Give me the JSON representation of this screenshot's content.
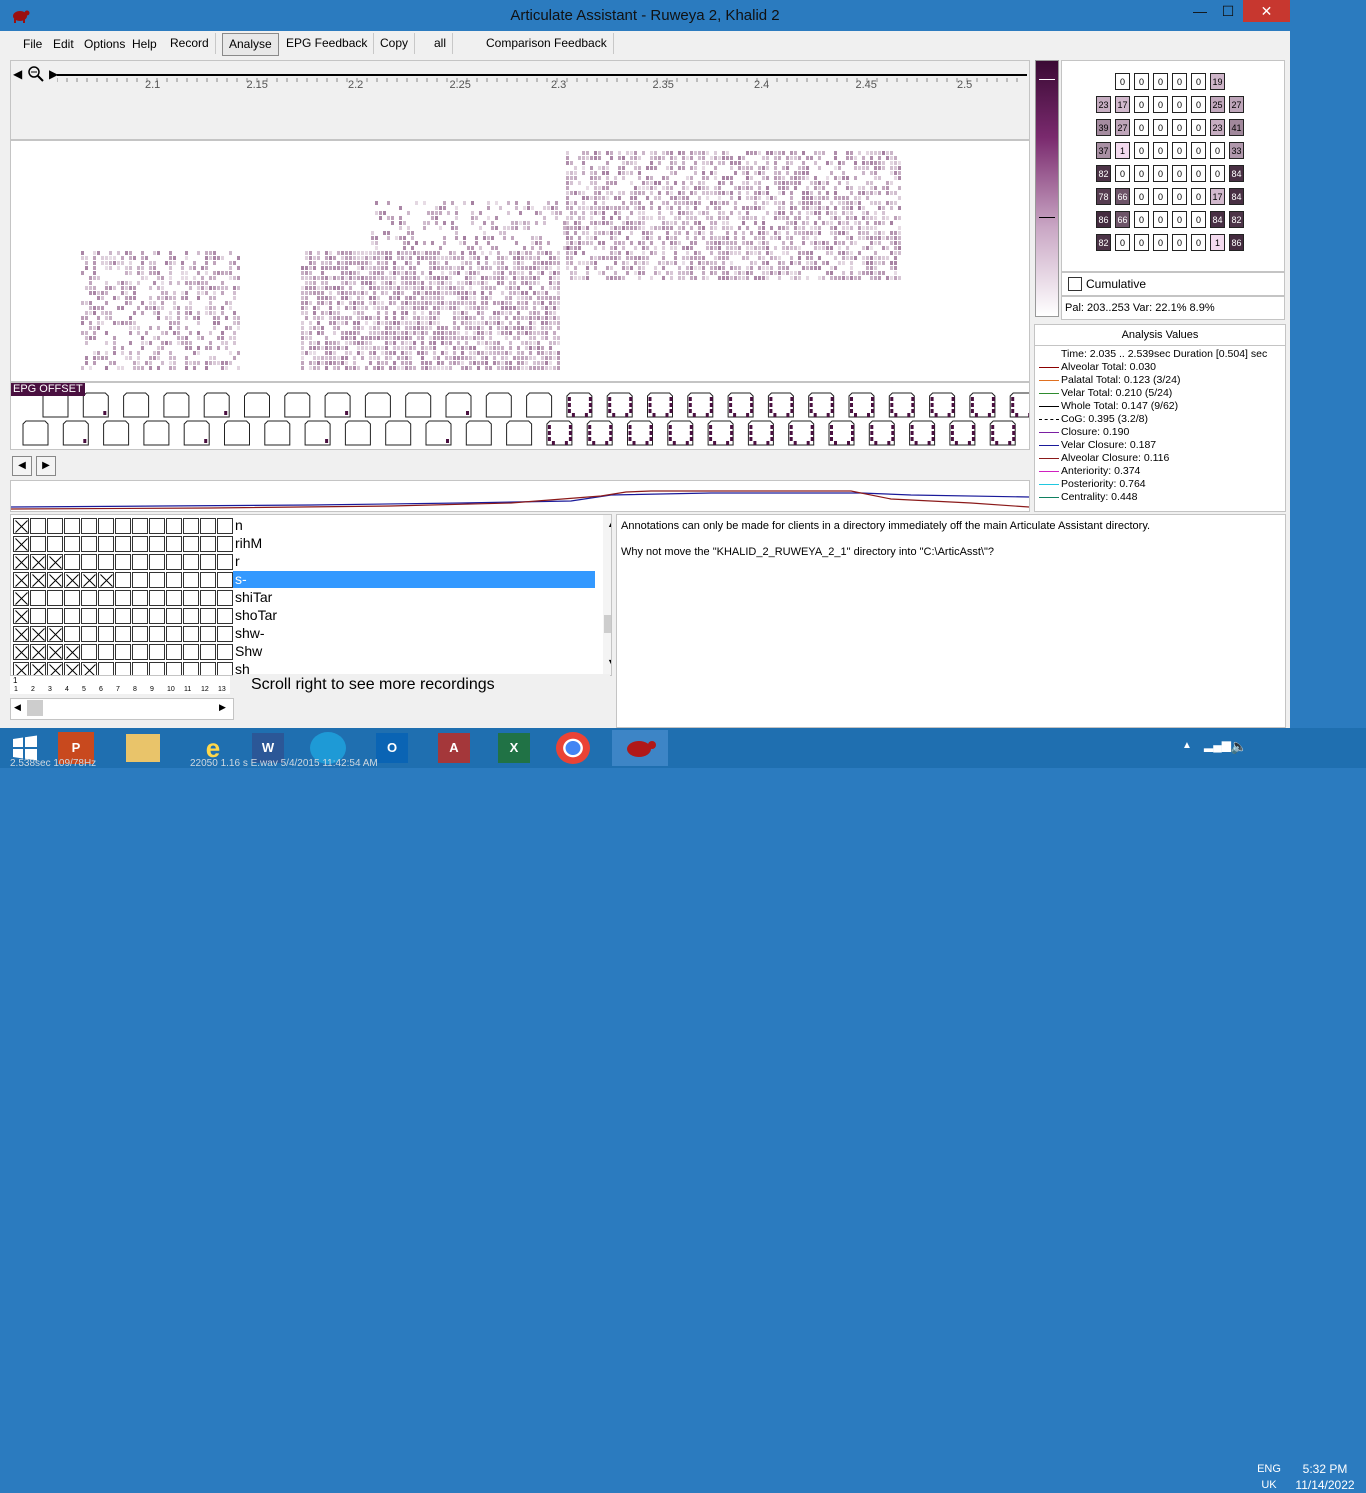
{
  "window": {
    "title": "Articulate Assistant - Ruweya 2, Khalid 2",
    "minimize_glyph": "—",
    "maximize_glyph": "☐",
    "close_glyph": "✕"
  },
  "menu": {
    "file": "File",
    "edit": "Edit",
    "options": "Options",
    "help": "Help",
    "record": "Record",
    "analyse": "Analyse",
    "epg_feedback": "EPG Feedback",
    "copy": "Copy",
    "all": "all",
    "comparison_feedback": "Comparison Feedback"
  },
  "timeline": {
    "ticks": [
      "2.1",
      "2.15",
      "2.2",
      "2.25",
      "2.3",
      "2.35",
      "2.4",
      "2.45",
      "2.5"
    ]
  },
  "epg": {
    "offset_label": "EPG OFFSET"
  },
  "palate_grid": [
    [
      "",
      "0",
      "0",
      "0",
      "0",
      "0",
      "19",
      ""
    ],
    [
      "23",
      "17",
      "0",
      "0",
      "0",
      "0",
      "25",
      "27"
    ],
    [
      "39",
      "27",
      "0",
      "0",
      "0",
      "0",
      "23",
      "41"
    ],
    [
      "37",
      "1",
      "0",
      "0",
      "0",
      "0",
      "0",
      "33"
    ],
    [
      "82",
      "0",
      "0",
      "0",
      "0",
      "0",
      "0",
      "84"
    ],
    [
      "78",
      "66",
      "0",
      "0",
      "0",
      "0",
      "17",
      "84"
    ],
    [
      "86",
      "66",
      "0",
      "0",
      "0",
      "0",
      "84",
      "82"
    ],
    [
      "82",
      "0",
      "0",
      "0",
      "0",
      "0",
      "1",
      "86"
    ]
  ],
  "cumulative_label": "Cumulative",
  "pal_text": "Pal: 203..253 Var: 22.1%  8.9%",
  "analysis": {
    "header": "Analysis Values",
    "rows": [
      {
        "text": "Time: 2.035 .. 2.539sec Duration [0.504] sec",
        "color": ""
      },
      {
        "text": "Alveolar Total: 0.030",
        "color": "#8b0000"
      },
      {
        "text": "Palatal Total: 0.123 (3/24)",
        "color": "#e07020"
      },
      {
        "text": "Velar Total: 0.210 (5/24)",
        "color": "#2e8b2e"
      },
      {
        "text": "Whole Total: 0.147 (9/62)",
        "color": "#000000"
      },
      {
        "text": "CoG: 0.395 (3.2/8)",
        "color": "#000000"
      },
      {
        "text": "Closure: 0.190",
        "color": "#7a1fa2"
      },
      {
        "text": "Velar Closure: 0.187",
        "color": "#1a1a9a"
      },
      {
        "text": "Alveolar Closure: 0.116",
        "color": "#8b1a1a"
      },
      {
        "text": "Anteriority: 0.374",
        "color": "#d020c0"
      },
      {
        "text": "Posteriority: 0.764",
        "color": "#20c8e0"
      },
      {
        "text": "Centrality: 0.448",
        "color": "#108060"
      }
    ]
  },
  "recordings": [
    {
      "name": "n",
      "checks": 1,
      "selected": false
    },
    {
      "name": "rihM",
      "checks": 1,
      "selected": false
    },
    {
      "name": "r",
      "checks": 3,
      "selected": false
    },
    {
      "name": "s-",
      "checks": 6,
      "selected": true
    },
    {
      "name": "shiTar",
      "checks": 1,
      "selected": false
    },
    {
      "name": "shoTar",
      "checks": 1,
      "selected": false
    },
    {
      "name": "shw-",
      "checks": 3,
      "selected": false
    },
    {
      "name": "Shw",
      "checks": 4,
      "selected": false
    },
    {
      "name": "sh",
      "checks": 5,
      "selected": false
    }
  ],
  "column_numbers": [
    "1",
    "2",
    "3",
    "4",
    "5",
    "6",
    "7",
    "8",
    "9",
    "10",
    "11",
    "12",
    "13"
  ],
  "column_top_number": "1",
  "scroll_hint": "Scroll right to see more recordings",
  "message": {
    "line1": "Annotations can only be made for clients in a directory immediately off the main Articulate Assistant directory.",
    "line2": "Why not move the \"KHALID_2_RUWEYA_2_1\" directory into \"C:\\ArticAsst\\\"?"
  },
  "taskbar": {
    "lang_top": "ENG",
    "lang_bottom": "UK",
    "time": "5:32 PM",
    "date": "11/14/2022",
    "status_under": "2.538sec 109/78Hz",
    "status_under2": "22050 1.16 s   E.wav  5/4/2015 11:42:54 AM"
  }
}
